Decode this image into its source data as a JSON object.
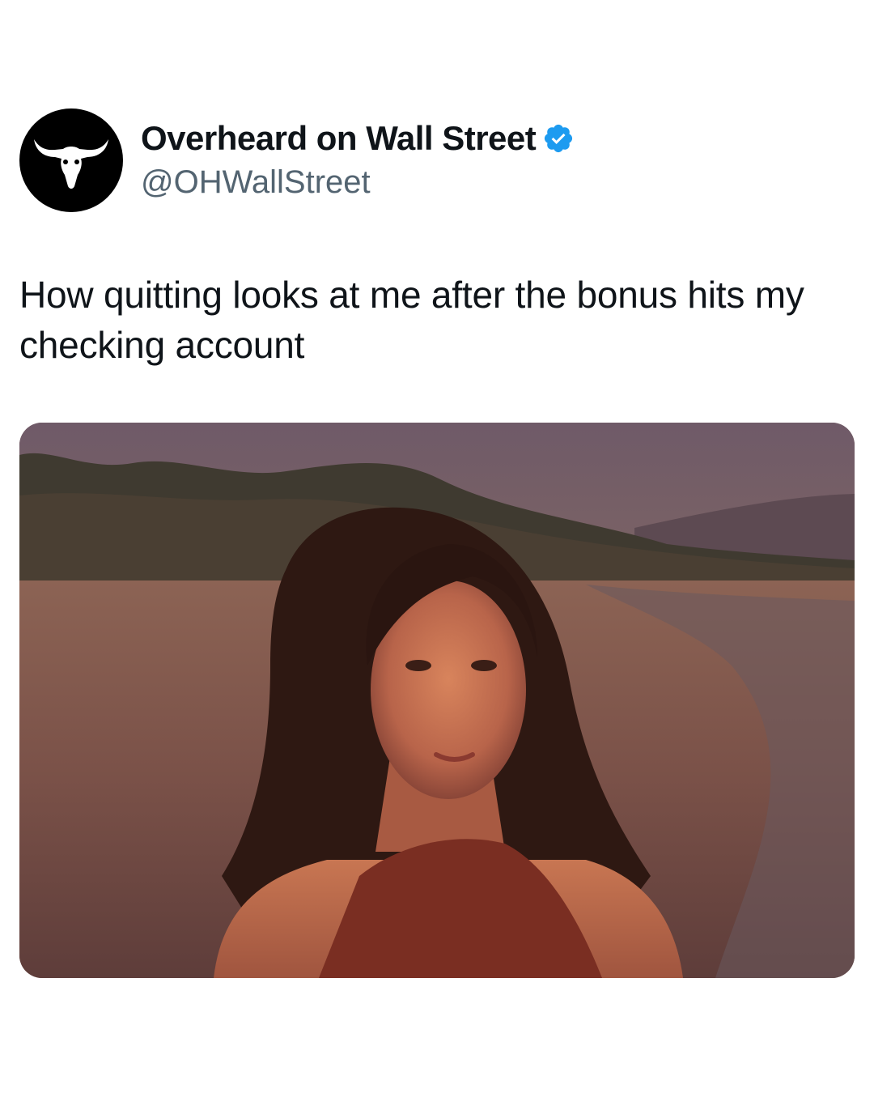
{
  "account": {
    "display_name": "Overheard on Wall Street",
    "handle": "@OHWallStreet",
    "verified": true,
    "avatar_icon": "bull-head-icon",
    "verified_icon": "verified-badge-icon",
    "verified_color": "#1d9bf0"
  },
  "tweet": {
    "text": "How quitting looks at me after the bonus hits my checking account"
  },
  "media": {
    "type": "photo",
    "icon": "photo-image"
  }
}
